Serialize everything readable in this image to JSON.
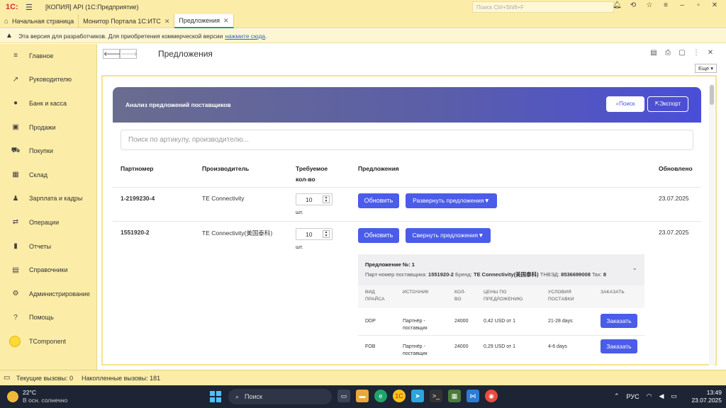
{
  "titlebar": {
    "logo": "1С:",
    "title": "[КОПИЯ] API  (1С:Предприятие)",
    "search_placeholder": "Поиск Ctrl+Shift+F"
  },
  "tabs": [
    {
      "label": "Начальная страница"
    },
    {
      "label": "Монитор Портала 1С:ИТС"
    },
    {
      "label": "Предложения"
    }
  ],
  "banner": {
    "text": "Эта версия для разработчиков. Для приобретения коммерческой версии",
    "link": "нажмите сюда",
    "tail": "."
  },
  "sidebar": {
    "items": [
      {
        "label": "Главное",
        "icon": "menu-icon"
      },
      {
        "label": "Руководителю",
        "icon": "trend-icon"
      },
      {
        "label": "Банк и касса",
        "icon": "coin-icon"
      },
      {
        "label": "Продажи",
        "icon": "bag-icon"
      },
      {
        "label": "Покупки",
        "icon": "cart-icon"
      },
      {
        "label": "Склад",
        "icon": "grid-icon"
      },
      {
        "label": "Зарплата и кадры",
        "icon": "person-icon"
      },
      {
        "label": "Операции",
        "icon": "operations-icon"
      },
      {
        "label": "Отчеты",
        "icon": "bar-chart-icon"
      },
      {
        "label": "Справочники",
        "icon": "book-icon"
      },
      {
        "label": "Администрирование",
        "icon": "gear-icon"
      },
      {
        "label": "Помощь",
        "icon": "help-icon"
      },
      {
        "label": "TComponent",
        "icon": "component-icon"
      }
    ]
  },
  "form": {
    "title": "Предложения",
    "more_label": "Еще"
  },
  "panel": {
    "title": "Анализ предложений поставщиков",
    "search_btn": "Поиск",
    "export_btn": "Экспорт",
    "search_placeholder": "Поиск по артикулу, производителю..."
  },
  "table": {
    "headers": {
      "part": "Партномер",
      "maker": "Производитель",
      "qty_line1": "Требуемое",
      "qty_line2": "кол-во",
      "offers": "Предложения",
      "updated": "Обновлено"
    },
    "rows": [
      {
        "part": "1-2199230-4",
        "maker": "TE Connectivity",
        "qty": "10",
        "unit": "шт.",
        "refresh": "Обновить",
        "toggle": "Развернуть предложения▼",
        "updated": "23.07.2025"
      },
      {
        "part": "1551920-2",
        "maker": "TE Connectivity(美国泰科)",
        "qty": "10",
        "unit": "шт.",
        "refresh": "Обновить",
        "toggle": "Свернуть предложения▼",
        "updated": "23.07.2025"
      }
    ]
  },
  "offer": {
    "title": "Предложение №: 1",
    "meta_label1": "Парт-номер поставщика:",
    "meta_val1": "1551920-2",
    "meta_label2": "Бренд:",
    "meta_val2": "TE Connectivity(美国泰科)",
    "meta_label3": "ТНВЭД:",
    "meta_val3": "8536699008",
    "meta_label4": "Tax:",
    "meta_val4": "8",
    "cols": {
      "type_1": "ВИД",
      "type_2": "ПРАЙСА",
      "source": "ИСТОЧНИК",
      "qty_1": "КОЛ-",
      "qty_2": "ВО",
      "price_1": "ЦЕНЫ ПО",
      "price_2": "ПРЕДЛОЖЕНИЮ",
      "terms_1": "УСЛОВИЯ",
      "terms_2": "ПОСТАВКИ",
      "order": "ЗАКАЗАТЬ"
    },
    "rows": [
      {
        "type": "DDP",
        "source_1": "Партнёр -",
        "source_2": "поставщик",
        "qty": "24000",
        "price": "0,42 USD от 1",
        "terms": "21-28 days",
        "order": "Заказать"
      },
      {
        "type": "FOB",
        "source_1": "Партнёр -",
        "source_2": "поставщик",
        "qty": "24000",
        "price": "0,29 USD от 1",
        "terms": "4-6 days",
        "order": "Заказать"
      }
    ]
  },
  "statusbar": {
    "current": "Текущие вызовы: 0",
    "accumulated": "Накопленные вызовы: 181"
  },
  "taskbar": {
    "temp": "22°C",
    "weather": "В осн. солнечно",
    "search": "Поиск",
    "lang": "РУС",
    "time": "13:49",
    "date": "23.07.2025"
  }
}
